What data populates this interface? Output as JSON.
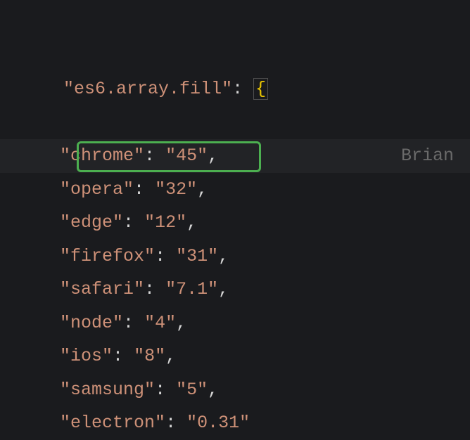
{
  "root_key": "es6.array.fill",
  "annotation": "Brian ",
  "entries": [
    {
      "key": "chrome",
      "value": "45",
      "highlighted": true
    },
    {
      "key": "opera",
      "value": "32",
      "highlighted": false
    },
    {
      "key": "edge",
      "value": "12",
      "highlighted": false
    },
    {
      "key": "firefox",
      "value": "31",
      "highlighted": false
    },
    {
      "key": "safari",
      "value": "7.1",
      "highlighted": false
    },
    {
      "key": "node",
      "value": "4",
      "highlighted": false
    },
    {
      "key": "ios",
      "value": "8",
      "highlighted": false
    },
    {
      "key": "samsung",
      "value": "5",
      "highlighted": false
    },
    {
      "key": "electron",
      "value": "0.31",
      "highlighted": false
    }
  ]
}
